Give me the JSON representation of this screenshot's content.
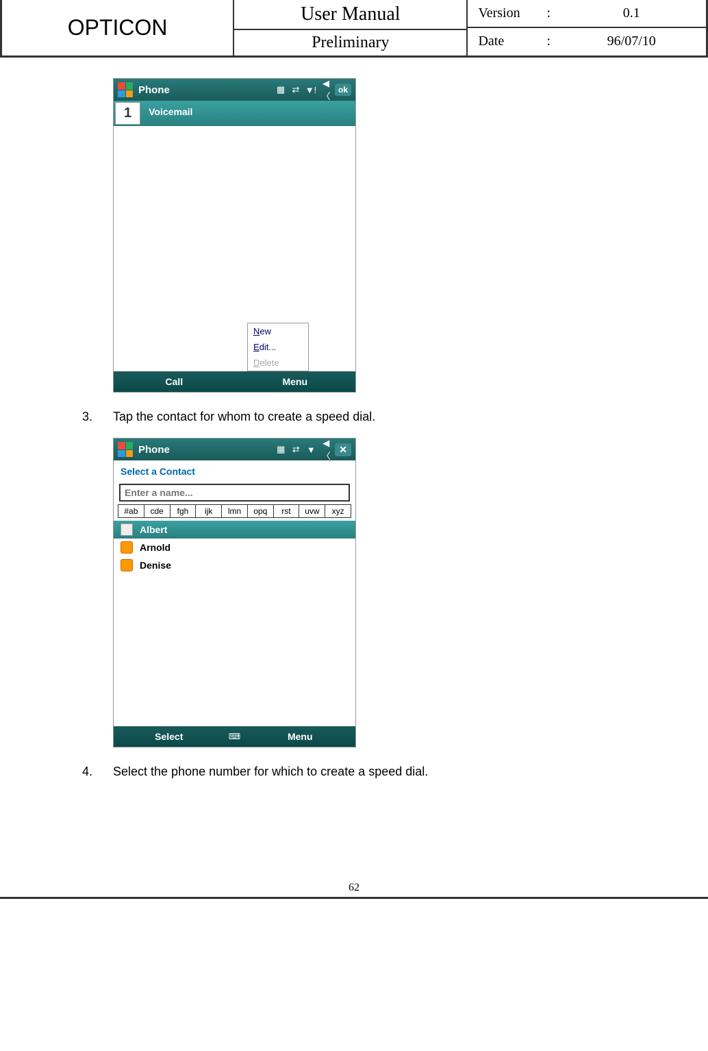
{
  "header": {
    "brand": "OPTICON",
    "title": "User Manual",
    "subtitle": "Preliminary",
    "version_label": "Version",
    "version_value": "0.1",
    "date_label": "Date",
    "date_value": "96/07/10"
  },
  "screenshot1": {
    "title": "Phone",
    "ok": "ok",
    "speed_num": "1",
    "speed_label": "Voicemail",
    "menu_new": "New",
    "menu_edit": "Edit...",
    "menu_delete": "Delete",
    "btn_call": "Call",
    "btn_menu": "Menu"
  },
  "step3": {
    "num": "3.",
    "text": "Tap the contact for whom to create a speed dial."
  },
  "screenshot2": {
    "title": "Phone",
    "heading": "Select a Contact",
    "placeholder": "Enter a name...",
    "tabs": [
      "#ab",
      "cde",
      "fgh",
      "ijk",
      "lmn",
      "opq",
      "rst",
      "uvw",
      "xyz"
    ],
    "contacts": [
      {
        "name": "Albert",
        "selected": true,
        "iconType": "card"
      },
      {
        "name": "Arnold",
        "selected": false,
        "iconType": "sim"
      },
      {
        "name": "Denise",
        "selected": false,
        "iconType": "sim"
      }
    ],
    "btn_select": "Select",
    "btn_menu": "Menu"
  },
  "step4": {
    "num": "4.",
    "text": "Select the phone number for which to create a speed dial."
  },
  "page_number": "62"
}
